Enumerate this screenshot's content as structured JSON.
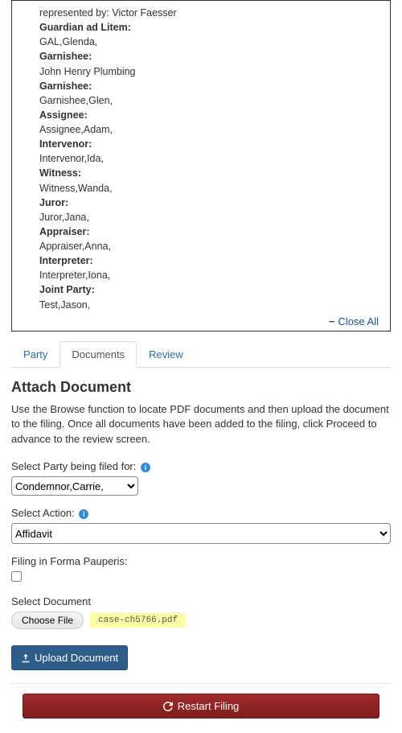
{
  "case": {
    "represented_prefix": "represented by: ",
    "represented_by": "Victor Faesser",
    "roles": [
      {
        "role": "Guardian ad Litem:",
        "value": "GAL,Glenda,"
      },
      {
        "role": "Garnishee:",
        "value": "John Henry Plumbing"
      },
      {
        "role": "Garnishee:",
        "value": "Garnishee,Glen,"
      },
      {
        "role": "Assignee:",
        "value": "Assignee,Adam,"
      },
      {
        "role": "Intervenor:",
        "value": "Intervenor,Ida,"
      },
      {
        "role": "Witness:",
        "value": "Witness,Wanda,"
      },
      {
        "role": "Juror:",
        "value": "Juror,Jana,"
      },
      {
        "role": "Appraiser:",
        "value": "Appraiser,Anna,"
      },
      {
        "role": "Interpreter:",
        "value": "Interpreter,Iona,"
      },
      {
        "role": "Joint Party:",
        "value": "Test,Jason,"
      }
    ],
    "close_all": "Close All"
  },
  "tabs": {
    "party": "Party",
    "documents": "Documents",
    "review": "Review"
  },
  "attach": {
    "heading": "Attach Document",
    "desc": "Use the Browse function to locate PDF documents and then upload the document to the filing. Once all documents have been added to the filing, click Proceed to advance to the review screen."
  },
  "form": {
    "party_label": "Select Party being filed for:",
    "party_value": "Condemnor,Carrie,",
    "action_label": "Select Action:",
    "action_value": "Affidavit",
    "pauperis_label": "Filing in Forma Pauperis:",
    "select_doc_label": "Select Document",
    "choose_file": "Choose File",
    "file_name": "case-ch5766.pdf",
    "upload_btn": "Upload Document"
  },
  "restart": "Restart Filing"
}
